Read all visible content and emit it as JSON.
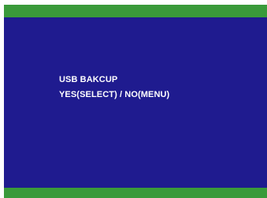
{
  "osd": {
    "title": "USB BAKCUP",
    "prompt": "YES(SELECT) / NO(MENU)"
  },
  "colors": {
    "bar": "#3a9a3a",
    "panel": "#1f1b8f",
    "text": "#ffffff"
  }
}
